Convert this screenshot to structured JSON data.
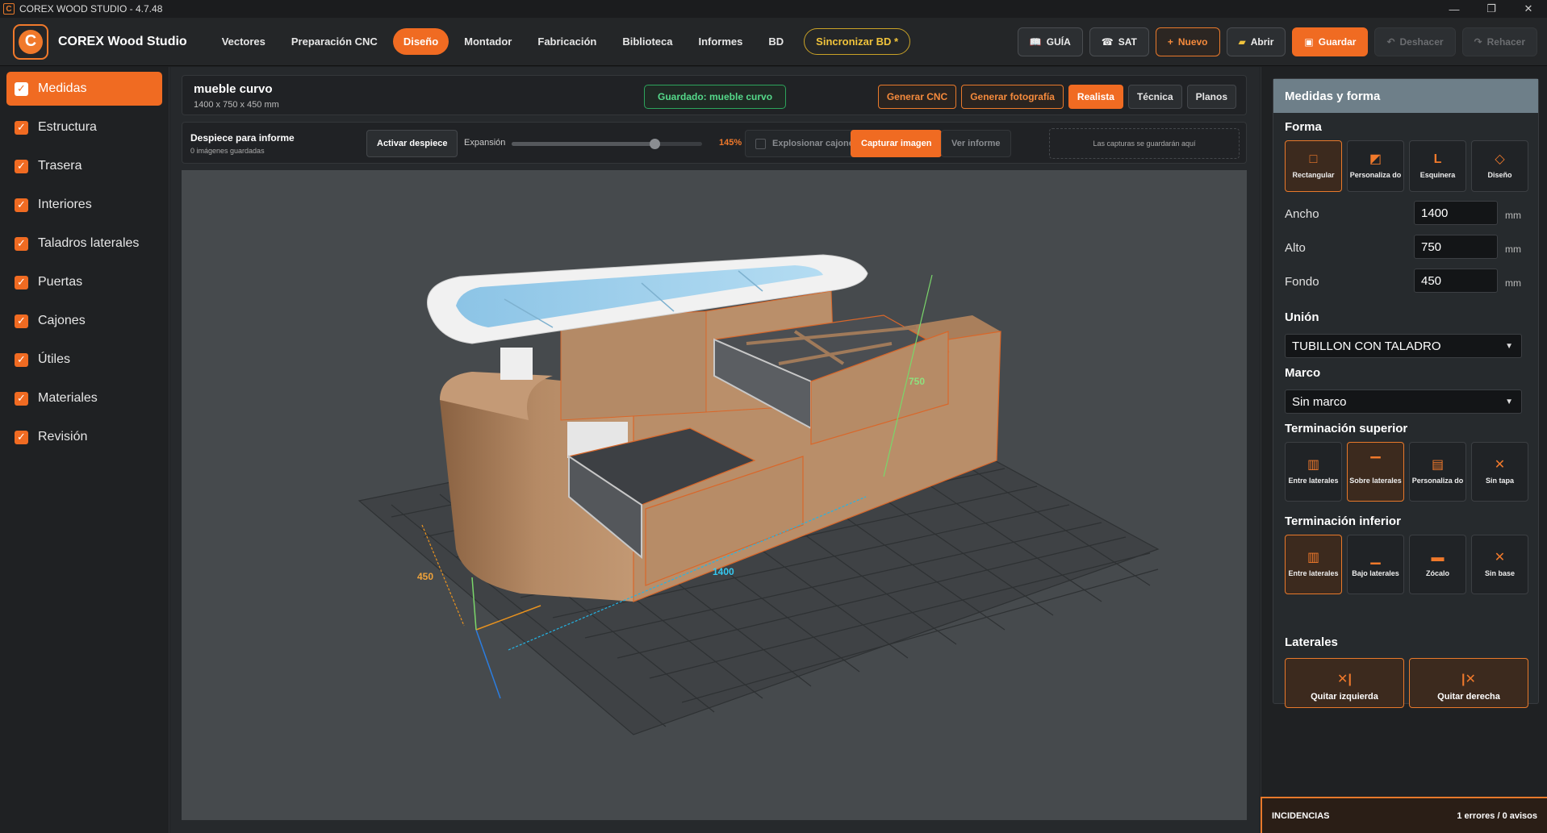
{
  "window": {
    "title": "COREX WOOD STUDIO - 4.7.48",
    "app_icon": "C"
  },
  "brand": {
    "logo_letter": "C",
    "name": "COREX Wood Studio"
  },
  "nav": {
    "items": [
      "Vectores",
      "Preparación CNC",
      "Diseño",
      "Montador",
      "Fabricación",
      "Biblioteca",
      "Informes",
      "BD"
    ],
    "active": "Diseño",
    "sync": "Sincronizar BD *"
  },
  "actions": {
    "guia": "GUÍA",
    "sat": "SAT",
    "nuevo": "Nuevo",
    "abrir": "Abrir",
    "guardar": "Guardar",
    "deshacer": "Deshacer",
    "rehacer": "Rehacer"
  },
  "sidebar": {
    "items": [
      {
        "label": "Medidas",
        "active": true
      },
      {
        "label": "Estructura"
      },
      {
        "label": "Trasera"
      },
      {
        "label": "Interiores"
      },
      {
        "label": "Taladros laterales"
      },
      {
        "label": "Puertas"
      },
      {
        "label": "Cajones"
      },
      {
        "label": "Útiles"
      },
      {
        "label": "Materiales"
      },
      {
        "label": "Revisión"
      }
    ]
  },
  "project": {
    "name": "mueble curvo",
    "dims": "1400 x 750 x 450 mm",
    "saved": "Guardado: mueble curvo",
    "buttons": {
      "cnc": "Generar CNC",
      "foto": "Generar fotografía",
      "realista": "Realista",
      "tecnica": "Técnica",
      "planos": "Planos"
    }
  },
  "despiece": {
    "title": "Despiece para informe",
    "sub": "0 imágenes guardadas",
    "activar": "Activar despiece",
    "expansion_label": "Expansión",
    "expansion_value": "145%",
    "expansion_fraction": 0.75,
    "explosionar": "Explosionar cajones",
    "capturar": "Capturar imagen",
    "ver": "Ver informe",
    "captures_hint": "Las capturas se guardarán aquí"
  },
  "viewport": {
    "dim_width": "1400",
    "dim_height": "750",
    "dim_depth": "450"
  },
  "right": {
    "title": "Medidas y forma",
    "forma_title": "Forma",
    "forma": [
      {
        "label": "Rectangular",
        "icon": "square-icon",
        "sel": true
      },
      {
        "label": "Personaliza do",
        "icon": "custom-shape-icon"
      },
      {
        "label": "Esquinera",
        "icon": "corner-icon"
      },
      {
        "label": "Diseño",
        "icon": "diamond-icon"
      }
    ],
    "fields": [
      {
        "label": "Ancho",
        "value": "1400",
        "unit": "mm"
      },
      {
        "label": "Alto",
        "value": "750",
        "unit": "mm"
      },
      {
        "label": "Fondo",
        "value": "450",
        "unit": "mm"
      }
    ],
    "union_title": "Unión",
    "union_value": "TUBILLON CON TALADRO",
    "marco_title": "Marco",
    "marco_value": "Sin marco",
    "tsup_title": "Terminación superior",
    "tsup": [
      {
        "label": "Entre laterales",
        "sel": false
      },
      {
        "label": "Sobre laterales",
        "sel": true
      },
      {
        "label": "Personaliza do",
        "sel": false
      },
      {
        "label": "Sin tapa",
        "sel": false
      }
    ],
    "tinf_title": "Terminación inferior",
    "tinf": [
      {
        "label": "Entre laterales",
        "sel": true
      },
      {
        "label": "Bajo laterales",
        "sel": false
      },
      {
        "label": "Zócalo",
        "sel": false
      },
      {
        "label": "Sin base",
        "sel": false
      }
    ],
    "laterales_title": "Laterales",
    "laterales": [
      "Quitar izquierda",
      "Quitar derecha"
    ]
  },
  "incidencias": {
    "label": "INCIDENCIAS",
    "value": "1 errores / 0 avisos"
  },
  "colors": {
    "accent": "#f06b22",
    "saved_green": "#55d98a",
    "sync_gold": "#f0c33c"
  }
}
